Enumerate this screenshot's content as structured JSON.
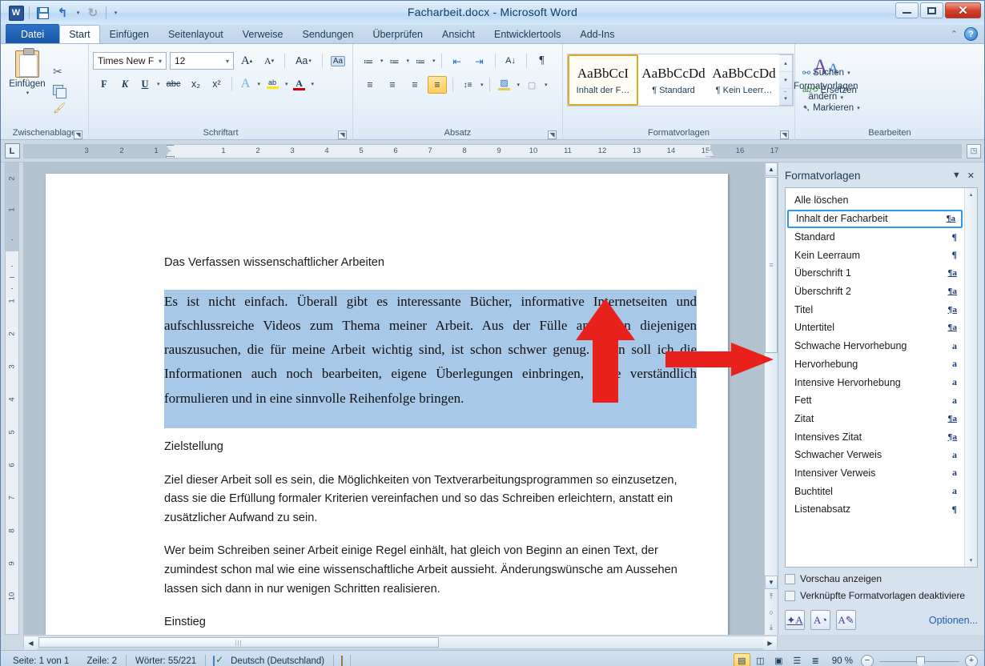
{
  "window": {
    "title": "Facharbeit.docx  -  Microsoft Word",
    "minimize": "minimize-icon",
    "maximize": "maximize-icon",
    "close": "✕"
  },
  "quick_access": {
    "app_logo": "W",
    "save": "save-icon",
    "undo": "↰",
    "undo_arrow": "▾",
    "redo": "↻",
    "customize": "▾"
  },
  "tabs": [
    {
      "label": "Datei",
      "type": "file"
    },
    {
      "label": "Start",
      "type": "active"
    },
    {
      "label": "Einfügen",
      "type": "normal"
    },
    {
      "label": "Seitenlayout",
      "type": "normal"
    },
    {
      "label": "Verweise",
      "type": "normal"
    },
    {
      "label": "Sendungen",
      "type": "normal"
    },
    {
      "label": "Überprüfen",
      "type": "normal"
    },
    {
      "label": "Ansicht",
      "type": "normal"
    },
    {
      "label": "Entwicklertools",
      "type": "normal"
    },
    {
      "label": "Add-Ins",
      "type": "normal"
    }
  ],
  "tab_right": {
    "collapse": "⌃",
    "help": "?"
  },
  "ribbon": {
    "clipboard": {
      "label": "Zwischenablage",
      "paste_label": "Einfügen",
      "paste_arrow": "▾",
      "cut": "✂",
      "copy": "copy-icon",
      "format_painter": "🖌",
      "launcher": "◥"
    },
    "font": {
      "label": "Schriftart",
      "font_name": "Times New F",
      "font_size": "12",
      "grow": "A",
      "grow_sup": "▴",
      "shrink": "A",
      "shrink_sup": "▾",
      "change_case": "Aa",
      "clear_format": "Aa",
      "bold": "F",
      "italic": "K",
      "underline": "U",
      "strikethrough": "abc",
      "subscript": "x₂",
      "superscript": "x²",
      "text_effects": "A",
      "highlight": "ab",
      "font_color": "A",
      "dropdown": "▾",
      "launcher": "◥"
    },
    "paragraph": {
      "label": "Absatz",
      "bullets": "≔",
      "numbering": "≔",
      "multilevel": "≔",
      "decrease_indent": "⇤",
      "increase_indent": "⇥",
      "sort": "A↓",
      "show_marks": "¶",
      "align_left": "≡",
      "align_center": "≡",
      "align_right": "≡",
      "justify": "≡",
      "line_spacing": "↕≡",
      "shading": "▨",
      "borders": "▢",
      "dropdown": "▾",
      "launcher": "◥"
    },
    "styles": {
      "label": "Formatvorlagen",
      "gallery": [
        {
          "sample": "AaBbCcI",
          "name": "Inhalt der F…",
          "selected": true
        },
        {
          "sample": "AaBbCcDd",
          "name": "¶ Standard",
          "selected": false
        },
        {
          "sample": "AaBbCcDd",
          "name": "¶ Kein Leerr…",
          "selected": false
        }
      ],
      "scroll_up": "▴",
      "scroll_down": "▾",
      "more": "▾",
      "change_styles_label": "Formatvorlagen\nändern",
      "change_styles_line1": "Formatvorlagen",
      "change_styles_line2": "ändern",
      "change_styles_arrow": "▾",
      "launcher": "◥"
    },
    "editing": {
      "label": "Bearbeiten",
      "find": "Suchen",
      "find_arrow": "▾",
      "replace": "Ersetzen",
      "select": "Markieren",
      "select_arrow": "▾",
      "find_icon": "binoculars-icon",
      "replace_icon": "replace-icon",
      "select_icon": "cursor-icon"
    }
  },
  "ruler": {
    "tab_selector": "L",
    "left_numbers": [
      "3",
      "2",
      "1"
    ],
    "right_numbers": [
      "1",
      "2",
      "3",
      "4",
      "5",
      "6",
      "7",
      "8",
      "9",
      "10",
      "11",
      "12",
      "13",
      "14",
      "15",
      "16",
      "17"
    ],
    "vertical_top_numbers": [
      "2",
      "1"
    ],
    "vertical_numbers": [
      "1",
      "2",
      "3",
      "4",
      "5",
      "6",
      "7",
      "8",
      "9",
      "10"
    ],
    "end_button": "◳"
  },
  "document": {
    "heading1": "Das Verfassen wissenschaftlicher Arbeiten",
    "selected_paragraph": "Es ist nicht einfach. Überall gibt es interessante Bücher, informative Internetseiten und aufschlussreiche Videos zum Thema meiner Arbeit. Aus der Fülle an Daten diejenigen rauszusuchen, die für meine Arbeit wichtig sind, ist schon schwer genug. Dann soll ich die Informationen auch noch bearbeiten, eigene Überlegungen einbringen, diese verständlich formulieren und in eine sinnvolle Reihenfolge bringen.",
    "heading2": "Zielstellung",
    "paragraph2": "Ziel dieser Arbeit soll es sein, die Möglichkeiten von Textverarbeitungsprogrammen so einzusetzen, dass sie die Erfüllung formaler Kriterien vereinfachen und so das Schreiben erleichtern, anstatt ein zusätzlicher Aufwand zu sein.",
    "paragraph3": "Wer beim Schreiben seiner Arbeit einige Regel einhält, hat gleich von Beginn an einen Text, der zumindest schon mal wie eine wissenschaftliche Arbeit aussieht. Änderungswünsche am Aussehen lassen sich dann in nur wenigen Schritten realisieren.",
    "heading3": "Einstieg"
  },
  "scrollbars": {
    "up": "▲",
    "down": "▼",
    "left": "◀",
    "right": "▶",
    "prev_page": "⤒",
    "browse_object": "○",
    "next_page": "⤓"
  },
  "styles_pane": {
    "title": "Formatvorlagen",
    "minimize": "▼",
    "close": "✕",
    "items": [
      {
        "label": "Alle löschen",
        "mark": "",
        "selected": false
      },
      {
        "label": "Inhalt der Facharbeit",
        "mark": "¶a",
        "mark_type": "para-char",
        "selected": true
      },
      {
        "label": "Standard",
        "mark": "¶",
        "mark_type": "para",
        "selected": false
      },
      {
        "label": "Kein Leerraum",
        "mark": "¶",
        "mark_type": "para",
        "selected": false
      },
      {
        "label": "Überschrift 1",
        "mark": "¶a",
        "mark_type": "para-char",
        "selected": false
      },
      {
        "label": "Überschrift 2",
        "mark": "¶a",
        "mark_type": "para-char",
        "selected": false
      },
      {
        "label": "Titel",
        "mark": "¶a",
        "mark_type": "para-char",
        "selected": false
      },
      {
        "label": "Untertitel",
        "mark": "¶a",
        "mark_type": "para-char",
        "selected": false
      },
      {
        "label": "Schwache Hervorhebung",
        "mark": "a",
        "mark_type": "char",
        "selected": false
      },
      {
        "label": "Hervorhebung",
        "mark": "a",
        "mark_type": "char",
        "selected": false
      },
      {
        "label": "Intensive Hervorhebung",
        "mark": "a",
        "mark_type": "char",
        "selected": false
      },
      {
        "label": "Fett",
        "mark": "a",
        "mark_type": "char",
        "selected": false
      },
      {
        "label": "Zitat",
        "mark": "¶a",
        "mark_type": "para-char",
        "selected": false
      },
      {
        "label": "Intensives Zitat",
        "mark": "¶a",
        "mark_type": "para-char",
        "selected": false
      },
      {
        "label": "Schwacher Verweis",
        "mark": "a",
        "mark_type": "char",
        "selected": false
      },
      {
        "label": "Intensiver Verweis",
        "mark": "a",
        "mark_type": "char",
        "selected": false
      },
      {
        "label": "Buchtitel",
        "mark": "a",
        "mark_type": "char",
        "selected": false
      },
      {
        "label": "Listenabsatz",
        "mark": "¶",
        "mark_type": "para",
        "selected": false
      }
    ],
    "checkbox_preview": "Vorschau anzeigen",
    "checkbox_disable_linked": "Verknüpfte Formatvorlagen deaktiviere",
    "button_new_style": "new-style-icon",
    "button_style_inspector": "style-inspector-icon",
    "button_manage_styles": "manage-styles-icon",
    "options_link": "Optionen...",
    "scroll_up": "▴",
    "scroll_down": "▾"
  },
  "status_bar": {
    "page": "Seite: 1 von 1",
    "line": "Zeile: 2",
    "words": "Wörter: 55/221",
    "proofing_icon": "spell-check-icon",
    "language": "Deutsch (Deutschland)",
    "macro_icon": "macro-record-icon",
    "views": [
      {
        "name": "print-layout",
        "glyph": "▤",
        "active": true
      },
      {
        "name": "full-screen-reading",
        "glyph": "◫",
        "active": false
      },
      {
        "name": "web-layout",
        "glyph": "▣",
        "active": false
      },
      {
        "name": "outline",
        "glyph": "☰",
        "active": false
      },
      {
        "name": "draft",
        "glyph": "≣",
        "active": false
      }
    ],
    "zoom": "90 %",
    "zoom_out": "−",
    "zoom_in": "+"
  },
  "annotations": {
    "arrow_up_color": "#e8211c",
    "arrow_right_color": "#e8211c"
  },
  "colors": {
    "accent_blue": "#2a9bf0",
    "selection_blue": "#a8c8e8",
    "red_annotation": "#e8211c",
    "gold_highlight": "#ffcd5c"
  }
}
